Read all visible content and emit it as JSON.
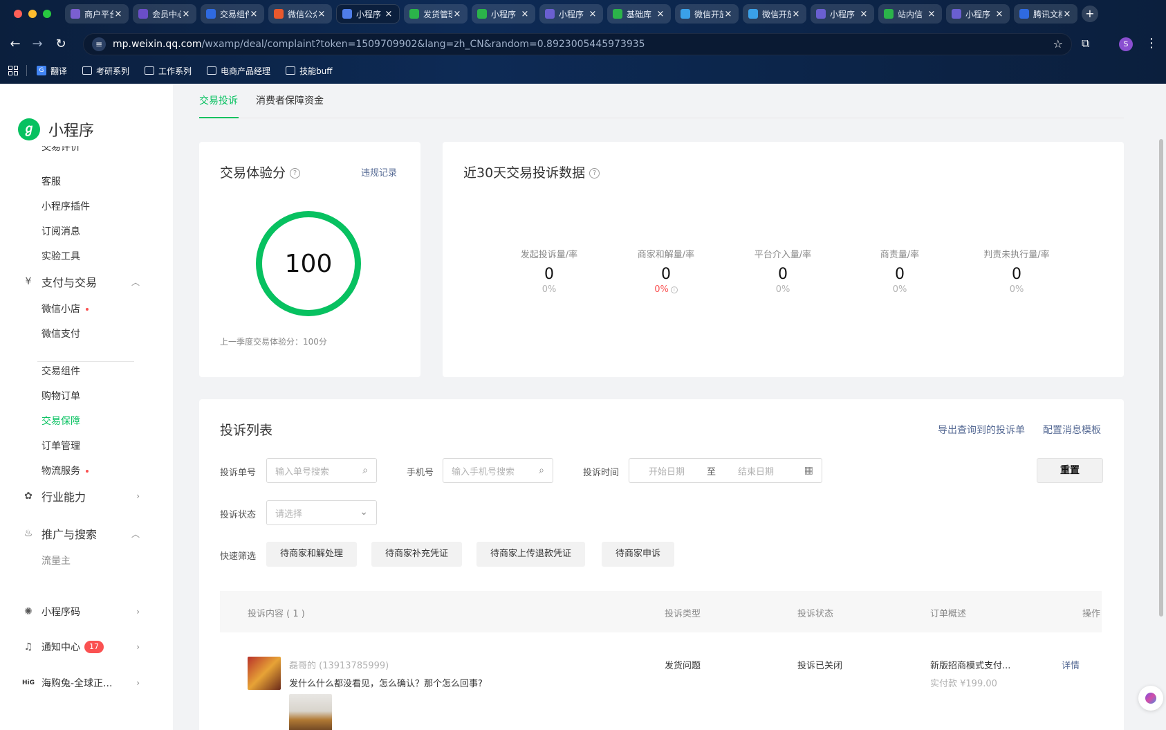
{
  "browser": {
    "tabs": [
      {
        "title": "商户平台",
        "color": "#7a5fd0"
      },
      {
        "title": "会员中心",
        "color": "#6a4ec8"
      },
      {
        "title": "交易组件",
        "color": "#2f6ae0"
      },
      {
        "title": "微信公众",
        "color": "#e9582c"
      },
      {
        "title": "小程序",
        "color": "#4f7de8",
        "active": true
      },
      {
        "title": "发货管理",
        "color": "#2bb34a"
      },
      {
        "title": "小程序",
        "color": "#2bb34a"
      },
      {
        "title": "小程序",
        "color": "#6a5fd0"
      },
      {
        "title": "基础库",
        "color": "#2bb34a"
      },
      {
        "title": "微信开放",
        "color": "#3aa0e8"
      },
      {
        "title": "微信开放",
        "color": "#3aa0e8"
      },
      {
        "title": "小程序",
        "color": "#6a5fd0"
      },
      {
        "title": "站内信",
        "color": "#2bb34a"
      },
      {
        "title": "小程序",
        "color": "#6a5fd0"
      },
      {
        "title": "腾讯文档",
        "color": "#2f6ae0"
      }
    ],
    "url_host": "mp.weixin.qq.com",
    "url_rest": "/wxamp/deal/complaint?token=1509709902&lang=zh_CN&random=0.8923005445973935",
    "profile_initial": "S",
    "bookmarks": [
      {
        "label": "翻译",
        "icon": "google-translate-icon"
      },
      {
        "label": "考研系列",
        "icon": "folder-icon"
      },
      {
        "label": "工作系列",
        "icon": "folder-icon"
      },
      {
        "label": "电商产品经理",
        "icon": "folder-icon"
      },
      {
        "label": "技能buff",
        "icon": "folder-icon"
      }
    ]
  },
  "sidebar": {
    "logo_text": "小程序",
    "cut_item": "交易评价",
    "items": {
      "kefu": "客服",
      "plugin": "小程序插件",
      "subscribe": "订阅消息",
      "lab": "实验工具",
      "pay_group": "支付与交易",
      "wx_shop": "微信小店",
      "wx_pay": "微信支付",
      "trade_comp": "交易组件",
      "shop_order": "购物订单",
      "trade_guard": "交易保障",
      "order_mgmt": "订单管理",
      "logistics": "物流服务",
      "industry": "行业能力",
      "promo_group": "推广与搜索",
      "traffic": "流量主",
      "qrcode": "小程序码",
      "notify": "通知中心",
      "notify_badge": "17",
      "account": "海购兔-全球正..."
    }
  },
  "main": {
    "tabs": [
      "交易投诉",
      "消费者保障资金"
    ],
    "score_card": {
      "title": "交易体验分",
      "link": "违规记录",
      "score": "100",
      "note": "上一季度交易体验分：100分"
    },
    "stats_card": {
      "title": "近30天交易投诉数据",
      "stats": [
        {
          "label": "发起投诉量/率",
          "num": "0",
          "pct": "0%"
        },
        {
          "label": "商家和解量/率",
          "num": "0",
          "pct": "0%"
        },
        {
          "label": "平台介入量/率",
          "num": "0",
          "pct": "0%"
        },
        {
          "label": "商责量/率",
          "num": "0",
          "pct": "0%"
        },
        {
          "label": "判责未执行量/率",
          "num": "0",
          "pct": "0%"
        }
      ]
    },
    "list": {
      "title": "投诉列表",
      "export_link": "导出查询到的投诉单",
      "template_link": "配置消息模板",
      "filters": {
        "order_label": "投诉单号",
        "order_placeholder": "输入单号搜索",
        "phone_label": "手机号",
        "phone_placeholder": "输入手机号搜索",
        "time_label": "投诉时间",
        "start_placeholder": "开始日期",
        "to": "至",
        "end_placeholder": "结束日期",
        "reset": "重置",
        "status_label": "投诉状态",
        "status_placeholder": "请选择",
        "quick_label": "快速筛选",
        "chips": [
          "待商家和解处理",
          "待商家补充凭证",
          "待商家上传退款凭证",
          "待商家申诉"
        ]
      },
      "columns": [
        "投诉内容 ( 1 )",
        "投诉类型",
        "投诉状态",
        "订单概述",
        "操作"
      ],
      "rows": [
        {
          "user": "磊哥的 (13913785999)",
          "content": "发什么什么都没看见，怎么确认？那个怎么回事?",
          "type": "发货问题",
          "status": "投诉已关闭",
          "order": "新版招商模式支付...",
          "paid": "实付款 ¥199.00",
          "action": "详情"
        }
      ]
    }
  }
}
